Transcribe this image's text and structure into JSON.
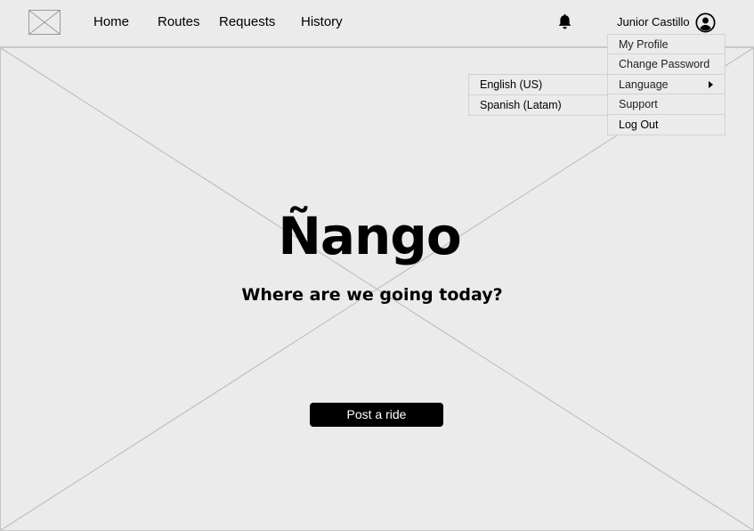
{
  "header": {
    "logo_icon": "image-placeholder-icon",
    "nav": [
      "Home",
      "Routes",
      "Requests",
      "History"
    ],
    "notifications_icon": "bell-icon",
    "user_name": "Junior Castillo",
    "avatar_icon": "user-circle-icon"
  },
  "hero": {
    "background": "image-placeholder",
    "brand": "Ñango",
    "tagline": "Where are we going today?",
    "cta_label": "Post a ride"
  },
  "user_menu": {
    "items": [
      "My Profile",
      "Change Password",
      "Language",
      "Support",
      "Log Out"
    ],
    "submenu_indicator_icon": "caret-right-icon"
  },
  "language_menu": {
    "items": [
      "English (US)",
      "Spanish (Latam)"
    ]
  },
  "colors": {
    "background": "#ebebeb",
    "border": "#c7c7c7",
    "primary_button": "#000000",
    "primary_button_text": "#ffffff"
  }
}
